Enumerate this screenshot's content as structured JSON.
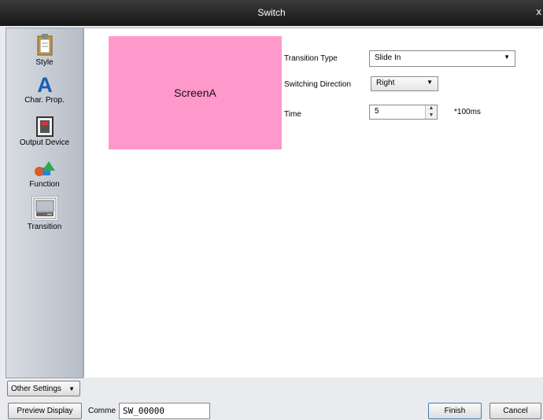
{
  "window": {
    "title": "Switch",
    "close_glyph": "x"
  },
  "sidebar": {
    "items": [
      {
        "label": "Style",
        "icon": "clipboard-icon"
      },
      {
        "label": "Char. Prop.",
        "icon": "letter-a-icon"
      },
      {
        "label": "Output Device",
        "icon": "output-device-icon"
      },
      {
        "label": "Function",
        "icon": "shapes-icon"
      },
      {
        "label": "Transition",
        "icon": "transition-icon"
      }
    ],
    "other_settings": "Other Settings"
  },
  "preview": {
    "screen_label": "ScreenA"
  },
  "properties": {
    "transition_type_label": "Transition Type",
    "transition_type_value": "Slide In",
    "switching_direction_label": "Switching Direction",
    "switching_direction_value": "Right",
    "time_label": "Time",
    "time_value": "5",
    "time_unit": "*100ms"
  },
  "footer": {
    "preview_display": "Preview Display",
    "comment_label": "Comme",
    "comment_value": "SW_00000",
    "finish": "Finish",
    "cancel": "Cancel"
  },
  "colors": {
    "preview_fill": "#ff99cc",
    "titlebar": "#1f1f1f"
  }
}
